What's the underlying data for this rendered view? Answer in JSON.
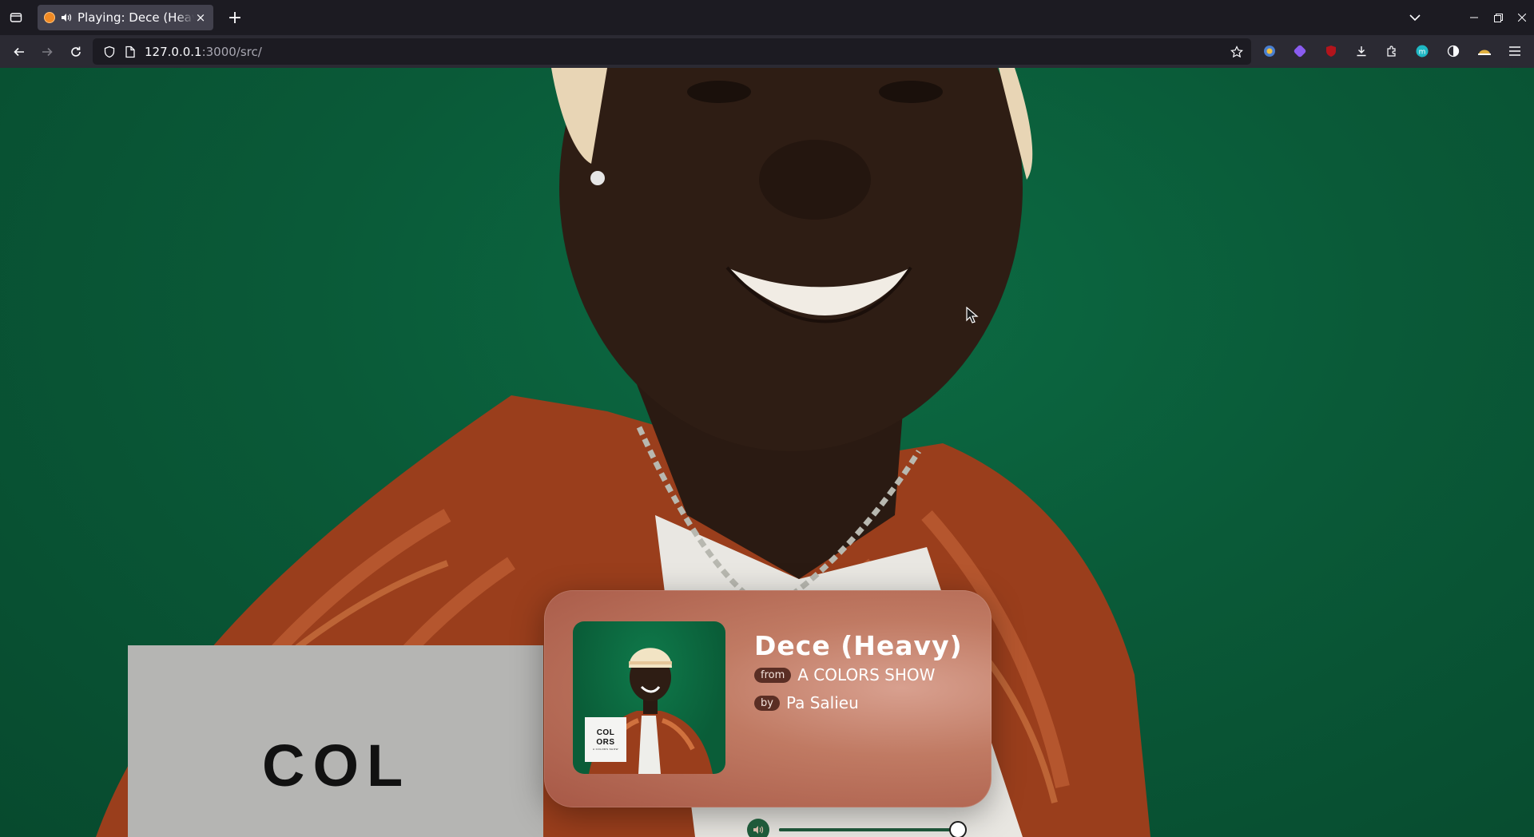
{
  "browser": {
    "tab_title": "Playing: Dece (Heavy)",
    "tab_close": "×",
    "new_tab": "+",
    "url_host": "127.0.0.1",
    "url_rest": ":3000/src/"
  },
  "page": {
    "background_text": "COL",
    "album_label": {
      "line1": "COL",
      "line2": "ORS",
      "line3": "A COLORS SHOW"
    }
  },
  "player": {
    "title": "Dece (Heavy)",
    "from_label": "from",
    "album": "A COLORS SHOW",
    "by_label": "by",
    "artist": "Pa Salieu",
    "volume": 1.0
  },
  "colors": {
    "accent": "#1e5438",
    "card": "#c07a63",
    "background": "#0a5a38"
  }
}
